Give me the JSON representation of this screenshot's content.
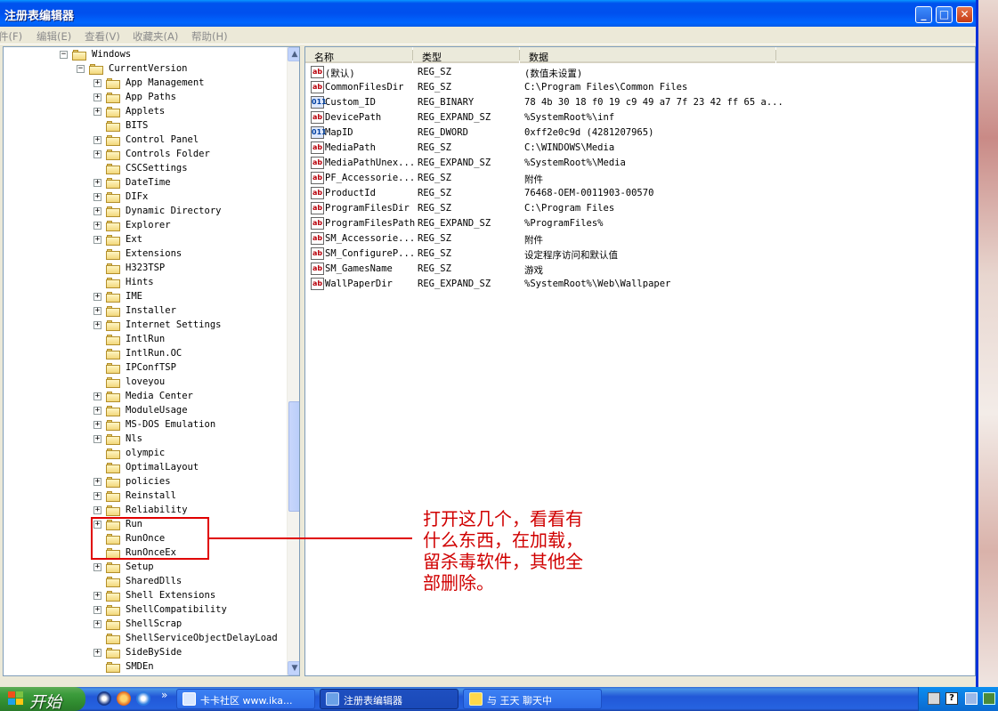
{
  "window": {
    "title": "注册表编辑器",
    "controls": {
      "minimize": "_",
      "maximize": "□",
      "close": "✕"
    }
  },
  "menu": [
    {
      "label": "件(F)"
    },
    {
      "label": "编辑(E)"
    },
    {
      "label": "查看(V)"
    },
    {
      "label": "收藏夹(A)"
    },
    {
      "label": "帮助(H)"
    }
  ],
  "tree": {
    "items": [
      {
        "label": "Windows",
        "expander": "−"
      },
      {
        "label": "CurrentVersion",
        "expander": "−"
      },
      {
        "label": "App Management",
        "expander": "+"
      },
      {
        "label": "App Paths",
        "expander": "+"
      },
      {
        "label": "Applets",
        "expander": "+"
      },
      {
        "label": "BITS",
        "expander": ""
      },
      {
        "label": "Control Panel",
        "expander": "+"
      },
      {
        "label": "Controls Folder",
        "expander": "+"
      },
      {
        "label": "CSCSettings",
        "expander": ""
      },
      {
        "label": "DateTime",
        "expander": "+"
      },
      {
        "label": "DIFx",
        "expander": "+"
      },
      {
        "label": "Dynamic Directory",
        "expander": "+"
      },
      {
        "label": "Explorer",
        "expander": "+"
      },
      {
        "label": "Ext",
        "expander": "+"
      },
      {
        "label": "Extensions",
        "expander": ""
      },
      {
        "label": "H323TSP",
        "expander": ""
      },
      {
        "label": "Hints",
        "expander": ""
      },
      {
        "label": "IME",
        "expander": "+"
      },
      {
        "label": "Installer",
        "expander": "+"
      },
      {
        "label": "Internet Settings",
        "expander": "+"
      },
      {
        "label": "IntlRun",
        "expander": ""
      },
      {
        "label": "IntlRun.OC",
        "expander": ""
      },
      {
        "label": "IPConfTSP",
        "expander": ""
      },
      {
        "label": "loveyou",
        "expander": ""
      },
      {
        "label": "Media Center",
        "expander": "+"
      },
      {
        "label": "ModuleUsage",
        "expander": "+"
      },
      {
        "label": "MS-DOS Emulation",
        "expander": "+"
      },
      {
        "label": "Nls",
        "expander": "+"
      },
      {
        "label": "olympic",
        "expander": ""
      },
      {
        "label": "OptimalLayout",
        "expander": ""
      },
      {
        "label": "policies",
        "expander": "+"
      },
      {
        "label": "Reinstall",
        "expander": "+"
      },
      {
        "label": "Reliability",
        "expander": "+"
      },
      {
        "label": "Run",
        "expander": "+"
      },
      {
        "label": "RunOnce",
        "expander": ""
      },
      {
        "label": "RunOnceEx",
        "expander": ""
      },
      {
        "label": "Setup",
        "expander": "+"
      },
      {
        "label": "SharedDlls",
        "expander": ""
      },
      {
        "label": "Shell Extensions",
        "expander": "+"
      },
      {
        "label": "ShellCompatibility",
        "expander": "+"
      },
      {
        "label": "ShellScrap",
        "expander": "+"
      },
      {
        "label": "ShellServiceObjectDelayLoad",
        "expander": ""
      },
      {
        "label": "SideBySide",
        "expander": "+"
      },
      {
        "label": "SMDEn",
        "expander": ""
      }
    ]
  },
  "list": {
    "columns": [
      "名称",
      "类型",
      "数据"
    ],
    "rows": [
      {
        "icon": "ab",
        "name": "(默认)",
        "type": "REG_SZ",
        "data": "(数值未设置)"
      },
      {
        "icon": "ab",
        "name": "CommonFilesDir",
        "type": "REG_SZ",
        "data": "C:\\Program Files\\Common Files"
      },
      {
        "icon": "011",
        "name": "Custom_ID",
        "type": "REG_BINARY",
        "data": "78 4b 30 18 f0 19 c9 49 a7 7f 23 42 ff 65 a..."
      },
      {
        "icon": "ab",
        "name": "DevicePath",
        "type": "REG_EXPAND_SZ",
        "data": "%SystemRoot%\\inf"
      },
      {
        "icon": "011",
        "name": "MapID",
        "type": "REG_DWORD",
        "data": "0xff2e0c9d (4281207965)"
      },
      {
        "icon": "ab",
        "name": "MediaPath",
        "type": "REG_SZ",
        "data": "C:\\WINDOWS\\Media"
      },
      {
        "icon": "ab",
        "name": "MediaPathUnex...",
        "type": "REG_EXPAND_SZ",
        "data": "%SystemRoot%\\Media"
      },
      {
        "icon": "ab",
        "name": "PF_Accessorie...",
        "type": "REG_SZ",
        "data": "附件"
      },
      {
        "icon": "ab",
        "name": "ProductId",
        "type": "REG_SZ",
        "data": "76468-OEM-0011903-00570"
      },
      {
        "icon": "ab",
        "name": "ProgramFilesDir",
        "type": "REG_SZ",
        "data": "C:\\Program Files"
      },
      {
        "icon": "ab",
        "name": "ProgramFilesPath",
        "type": "REG_EXPAND_SZ",
        "data": "%ProgramFiles%"
      },
      {
        "icon": "ab",
        "name": "SM_Accessorie...",
        "type": "REG_SZ",
        "data": "附件"
      },
      {
        "icon": "ab",
        "name": "SM_ConfigureP...",
        "type": "REG_SZ",
        "data": "设定程序访问和默认值"
      },
      {
        "icon": "ab",
        "name": "SM_GamesName",
        "type": "REG_SZ",
        "data": "游戏"
      },
      {
        "icon": "ab",
        "name": "WallPaperDir",
        "type": "REG_EXPAND_SZ",
        "data": "%SystemRoot%\\Web\\Wallpaper"
      }
    ]
  },
  "annotation": {
    "text": "打开这几个，看看有什么东西，在加载，留杀毒软件，其他全部删除。",
    "color": "#e00000"
  },
  "taskbar": {
    "start_label": "开始",
    "more": "»",
    "buttons": [
      {
        "label": "卡卡社区 www.ika...",
        "active": false
      },
      {
        "label": "注册表编辑器",
        "active": true
      },
      {
        "label": "与 王天 聊天中",
        "active": false
      }
    ],
    "tray_time": "?"
  },
  "colors": {
    "titlebar": "#0054e3",
    "taskbar": "#245edb",
    "start": "#3c9c3c",
    "window_bg": "#ece9d8"
  }
}
